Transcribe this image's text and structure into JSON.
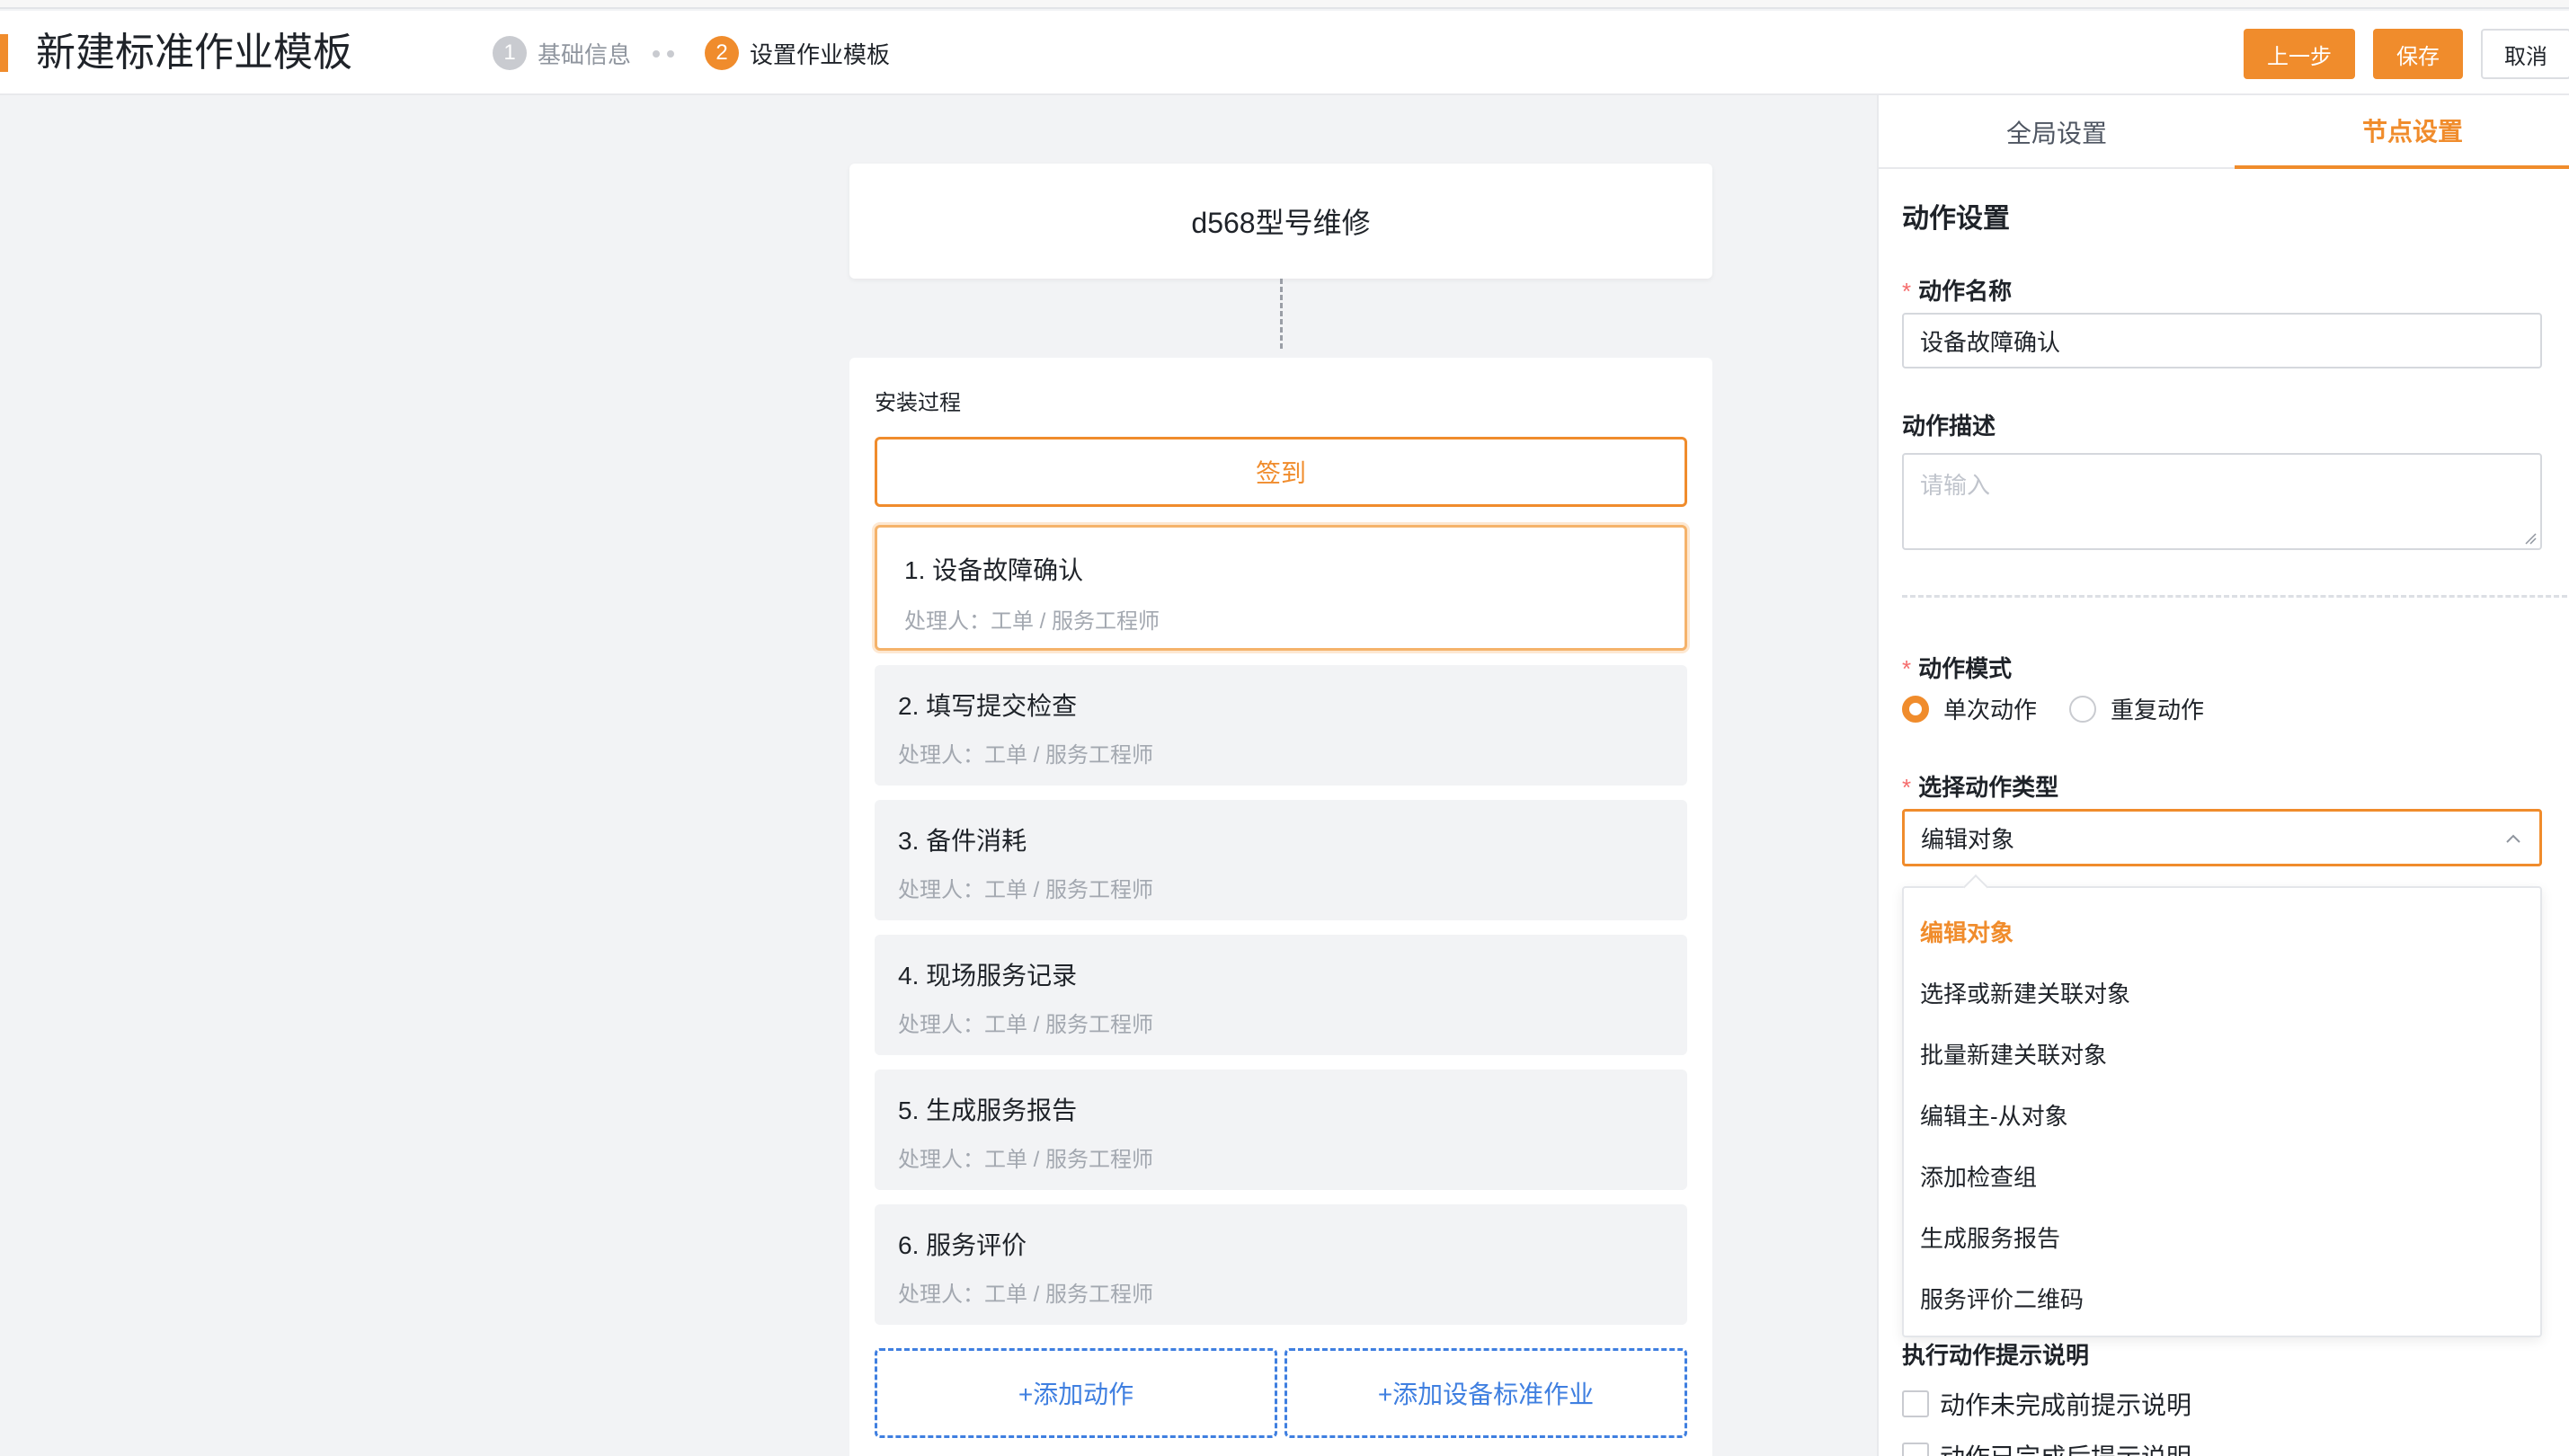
{
  "header": {
    "title": "新建标准作业模板",
    "steps": [
      {
        "num": "1",
        "label": "基础信息"
      },
      {
        "num": "2",
        "label": "设置作业模板"
      }
    ],
    "buttons": {
      "prev": "上一步",
      "save": "保存",
      "cancel": "取消"
    }
  },
  "canvas": {
    "start_title": "d568型号维修",
    "process_title": "安装过程",
    "checkin_label": "签到",
    "actions": [
      {
        "title": "1. 设备故障确认",
        "sub": "处理人：工单 / 服务工程师"
      },
      {
        "title": "2. 填写提交检查",
        "sub": "处理人：工单 / 服务工程师"
      },
      {
        "title": "3. 备件消耗",
        "sub": "处理人：工单 / 服务工程师"
      },
      {
        "title": "4. 现场服务记录",
        "sub": "处理人：工单 / 服务工程师"
      },
      {
        "title": "5. 生成服务报告",
        "sub": "处理人：工单 / 服务工程师"
      },
      {
        "title": "6. 服务评价",
        "sub": "处理人：工单 / 服务工程师"
      }
    ],
    "add_action": "+添加动作",
    "add_standard": "+添加设备标准作业"
  },
  "panel": {
    "tabs": {
      "global": "全局设置",
      "node": "节点设置"
    },
    "section_title": "动作设置",
    "required_mark": "*",
    "action_name_label": "动作名称",
    "action_name_value": "设备故障确认",
    "action_desc_label": "动作描述",
    "action_desc_placeholder": "请输入",
    "action_mode_label": "动作模式",
    "mode_options": [
      "单次动作",
      "重复动作"
    ],
    "mode_selected": "单次动作",
    "action_type_label": "选择动作类型",
    "action_type_value": "编辑对象",
    "type_options": [
      "编辑对象",
      "选择或新建关联对象",
      "批量新建关联对象",
      "编辑主-从对象",
      "添加检查组",
      "生成服务报告",
      "服务评价二维码"
    ],
    "hint_label": "执行动作提示说明",
    "hint_checks": [
      "动作未完成前提示说明",
      "动作已完成后提示说明"
    ]
  },
  "colors": {
    "accent": "#f08c2c",
    "link": "#3f7fe0"
  }
}
